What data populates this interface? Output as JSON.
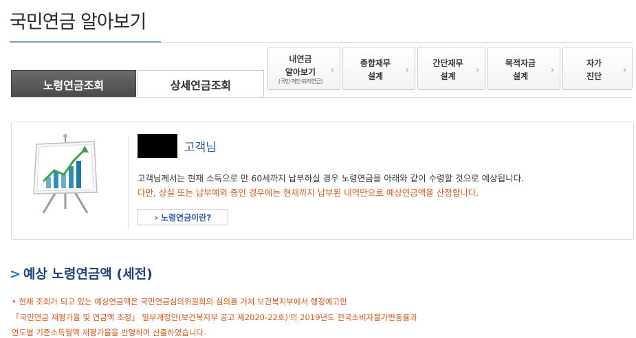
{
  "page": {
    "title": "국민연금 알아보기"
  },
  "tabs": [
    {
      "label": "노령연금조회",
      "active": true
    },
    {
      "label": "상세연금조회",
      "active": false
    }
  ],
  "quick_links": [
    {
      "label": "내연금\n알아보기",
      "sub": "(국민·개인·퇴직연금)",
      "icon": "chevron-right-icon"
    },
    {
      "label": "종합재무\n설계",
      "icon": "chevron-right-icon"
    },
    {
      "label": "간단재무\n설계",
      "icon": "chevron-right-icon"
    },
    {
      "label": "목적자금\n설계",
      "icon": "chevron-right-icon"
    },
    {
      "label": "자가\n진단",
      "icon": "chevron-right-icon"
    }
  ],
  "summary": {
    "customer_suffix": "고객님",
    "line1": "고객님께서는 현재 소득으로 만 60세까지 납부하실 경우 노령연금을 아래와 같이 수령할 것으로 예상됩니다.",
    "line2": "다만, 상실 또는 납부예외 중인 경우에는 현재까지 납부된 내역만으로 예상연금액을 산정합니다.",
    "link_label": "› 노령연금이란?",
    "illustration_icon": "presentation-chart-icon"
  },
  "section": {
    "title": "예상 노령연금액 (세전)",
    "marker": ">",
    "notes": [
      "• 현재 조회가 되고 있는 예상연금액은 국민연금심의위원회의 심의를 거쳐 보건복지부에서 행정예고한",
      "「국민연금 재평가율 및 연금액 조정」 일부개정안(보건복지부 공고 제2020-22호)'의 2019년도 전국소비자물가변동률과",
      "연도별 기준소득월액 재평가율을 반영하여 산출하였습니다."
    ]
  },
  "colors": {
    "accent_blue": "#2f5ea8",
    "notice_orange": "#d0561d",
    "tab_active_bg": "#555555"
  }
}
